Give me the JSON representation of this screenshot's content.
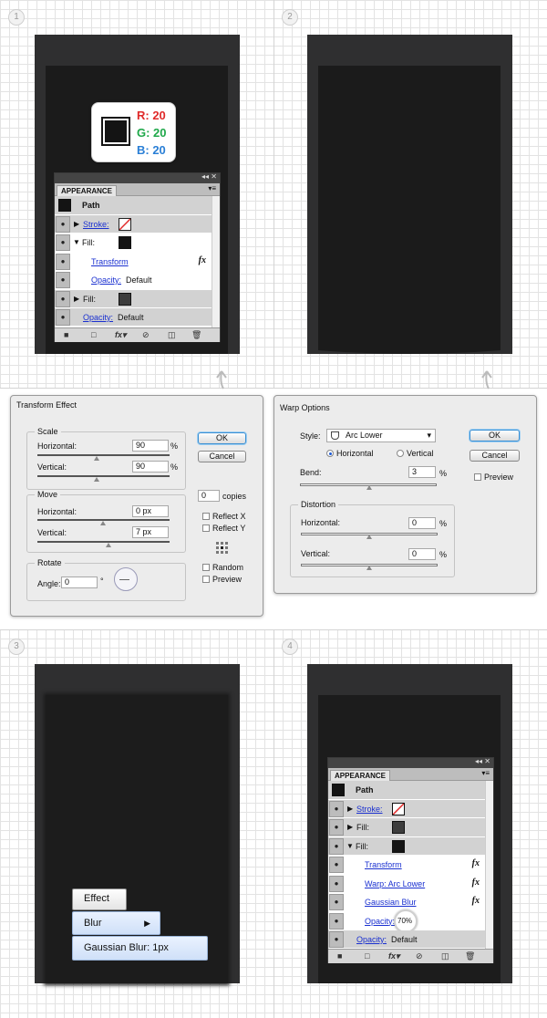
{
  "steps": [
    "1",
    "2",
    "3",
    "4"
  ],
  "color_swatch": {
    "r": "R: 20",
    "g": "G: 20",
    "b": "B: 20",
    "colors": {
      "r": "#e02a2a",
      "g": "#1fa84a",
      "b": "#2a7fd6",
      "fill": "#141414"
    }
  },
  "appearance1": {
    "tab": "APPEARANCE",
    "top_icons": "◂◂ ✕",
    "menu_icon": "▾≡",
    "path_label": "Path",
    "rows": [
      {
        "label": "Stroke:"
      },
      {
        "label": "Fill:"
      },
      {
        "label": "Transform",
        "fx": "fx"
      },
      {
        "label": "Opacity:",
        "value": "Default"
      },
      {
        "label": "Fill:"
      },
      {
        "label": "Opacity:",
        "value": "Default"
      }
    ]
  },
  "transform_effect": {
    "title": "Transform Effect",
    "scale": {
      "title": "Scale",
      "h_label": "Horizontal:",
      "h_value": "90",
      "v_label": "Vertical:",
      "v_value": "90",
      "unit": "%"
    },
    "move": {
      "title": "Move",
      "h_label": "Horizontal:",
      "h_value": "0 px",
      "v_label": "Vertical:",
      "v_value": "7 px"
    },
    "rotate": {
      "title": "Rotate",
      "angle_label": "Angle:",
      "angle_value": "0",
      "deg": "°"
    },
    "ok": "OK",
    "cancel": "Cancel",
    "copies_value": "0",
    "copies_label": "copies",
    "reflect_x": "Reflect X",
    "reflect_y": "Reflect Y",
    "random": "Random",
    "preview": "Preview"
  },
  "warp_options": {
    "title": "Warp Options",
    "style_label": "Style:",
    "style_value": "Arc Lower",
    "horizontal": "Horizontal",
    "vertical": "Vertical",
    "bend_label": "Bend:",
    "bend_value": "3",
    "unit": "%",
    "distortion": {
      "title": "Distortion",
      "h_label": "Horizontal:",
      "h_value": "0",
      "v_label": "Vertical:",
      "v_value": "0"
    },
    "ok": "OK",
    "cancel": "Cancel",
    "preview": "Preview"
  },
  "menu3": {
    "effect": "Effect",
    "blur": "Blur",
    "gaussian": "Gaussian Blur: 1px"
  },
  "appearance4": {
    "tab": "APPEARANCE",
    "top_icons": "◂◂ ✕",
    "menu_icon": "▾≡",
    "path_label": "Path",
    "rows": [
      {
        "label": "Stroke:"
      },
      {
        "label": "Fill:"
      },
      {
        "label": "Fill:"
      },
      {
        "label": "Transform",
        "fx": "fx"
      },
      {
        "label": "Warp: Arc Lower",
        "fx": "fx"
      },
      {
        "label": "Gaussian Blur",
        "fx": "fx"
      },
      {
        "label": "Opacity:",
        "value": "70%"
      },
      {
        "label": "Opacity:",
        "value": "Default"
      }
    ]
  }
}
